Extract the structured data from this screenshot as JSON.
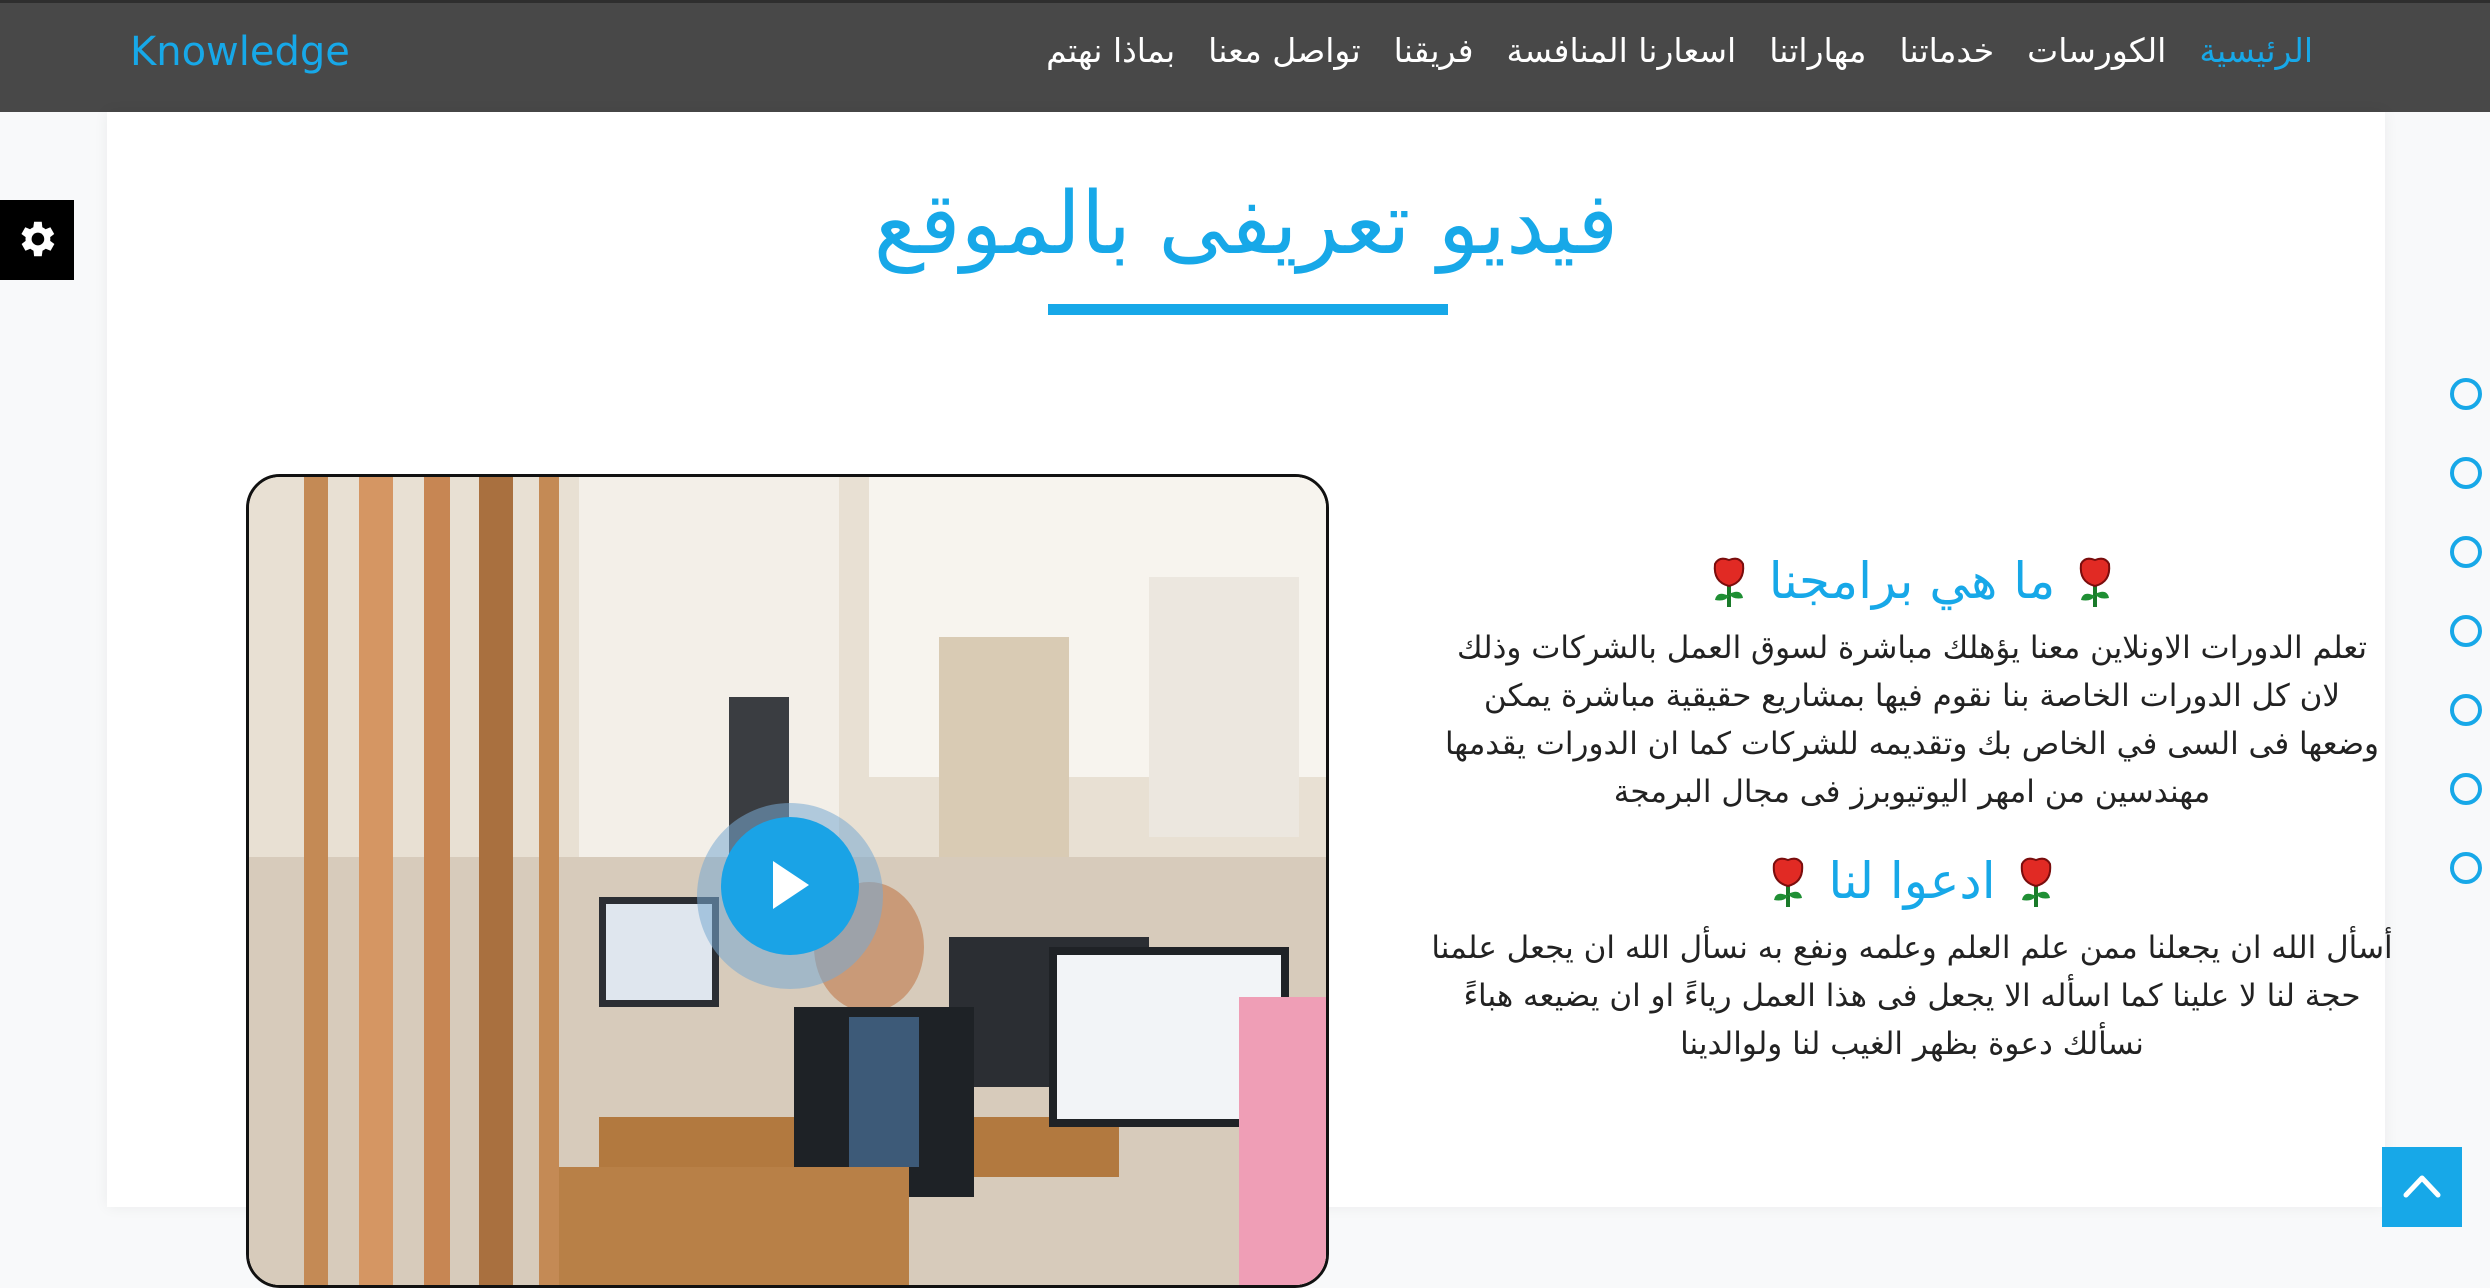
{
  "navbar": {
    "brand": "Knowledge",
    "items": [
      {
        "label": "الرئيسية",
        "active": true
      },
      {
        "label": "الكورسات"
      },
      {
        "label": "خدماتنا"
      },
      {
        "label": "مهاراتنا"
      },
      {
        "label": "اسعارنا المنافسة"
      },
      {
        "label": "فريقنا"
      },
      {
        "label": "تواصل معنا"
      },
      {
        "label": "بماذا نهتم"
      }
    ]
  },
  "section": {
    "title": "فيديو تعريفى بالموقع",
    "block1": {
      "heading": "ما هي برامجنا",
      "text": "تعلم الدورات الاونلاين معنا يؤهلك مباشرة لسوق العمل بالشركات وذلك\nلان كل الدورات الخاصة بنا نقوم فيها بمشاريع حقيقية مباشرة يمكن\nوضعها فى السى في الخاص بك وتقديمه للشركات كما ان الدورات يقدمها\nمهندسين من امهر اليوتيوبرز فى مجال البرمجة"
    },
    "block2": {
      "heading": "ادعوا لنا",
      "text": "أسأل الله ان يجعلنا ممن علم العلم وعلمه ونفع به نسأل الله ان يجعل علمنا\nحجة لنا لا علينا كما اسأله الا يجعل فى هذا العمل رياءً او ان يضيعه هباءً\nنسألك دعوة بظهر الغيب لنا ولوالدينا"
    }
  },
  "icons": {
    "settings": "gear-icon",
    "play": "play-icon",
    "heading_decoration": "rose-icon",
    "scroll_top": "chevron-up-icon",
    "side_nav": "circle-bullet-icon"
  },
  "colors": {
    "accent": "#17a8e8",
    "navbar_bg": "#484848"
  }
}
